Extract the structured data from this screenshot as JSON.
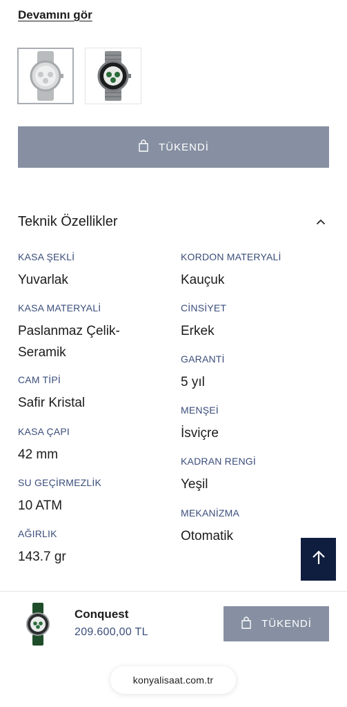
{
  "see_more_label": "Devamını gör",
  "thumbnails": [
    {
      "alt": "watch-grey-strap"
    },
    {
      "alt": "watch-steel-bracelet"
    }
  ],
  "sold_out_label": "TÜKENDİ",
  "specs": {
    "title": "Teknik Özellikler",
    "left": [
      {
        "label": "KASA ŞEKLİ",
        "value": "Yuvarlak"
      },
      {
        "label": "KASA MATERYALİ",
        "value": "Paslanmaz Çelik-Seramik"
      },
      {
        "label": "CAM TİPİ",
        "value": "Safir Kristal"
      },
      {
        "label": "KASA ÇAPI",
        "value": "42 mm"
      },
      {
        "label": "SU GEÇİRMEZLİK",
        "value": "10 ATM"
      },
      {
        "label": "AĞIRLIK",
        "value": "143.7 gr"
      }
    ],
    "right": [
      {
        "label": "KORDON MATERYALİ",
        "value": "Kauçuk"
      },
      {
        "label": "CİNSİYET",
        "value": "Erkek"
      },
      {
        "label": "GARANTİ",
        "value": "5 yıl"
      },
      {
        "label": "MENŞEİ",
        "value": "İsviçre"
      },
      {
        "label": "KADRAN RENGİ",
        "value": "Yeşil"
      },
      {
        "label": "MEKANİZMA",
        "value": "Otomatik"
      }
    ]
  },
  "sticky_bar": {
    "product_name": "Conquest",
    "price": "209.600,00 TL",
    "button_label": "TÜKENDİ"
  },
  "browser": {
    "url": "konyalisaat.com.tr"
  },
  "colors": {
    "button_bg": "#8690a2",
    "scroll_top_bg": "#0f1d3f",
    "label_color": "#3a4d7a"
  },
  "icons": [
    "shopping-bag-icon",
    "chevron-up-icon",
    "arrow-up-icon"
  ]
}
